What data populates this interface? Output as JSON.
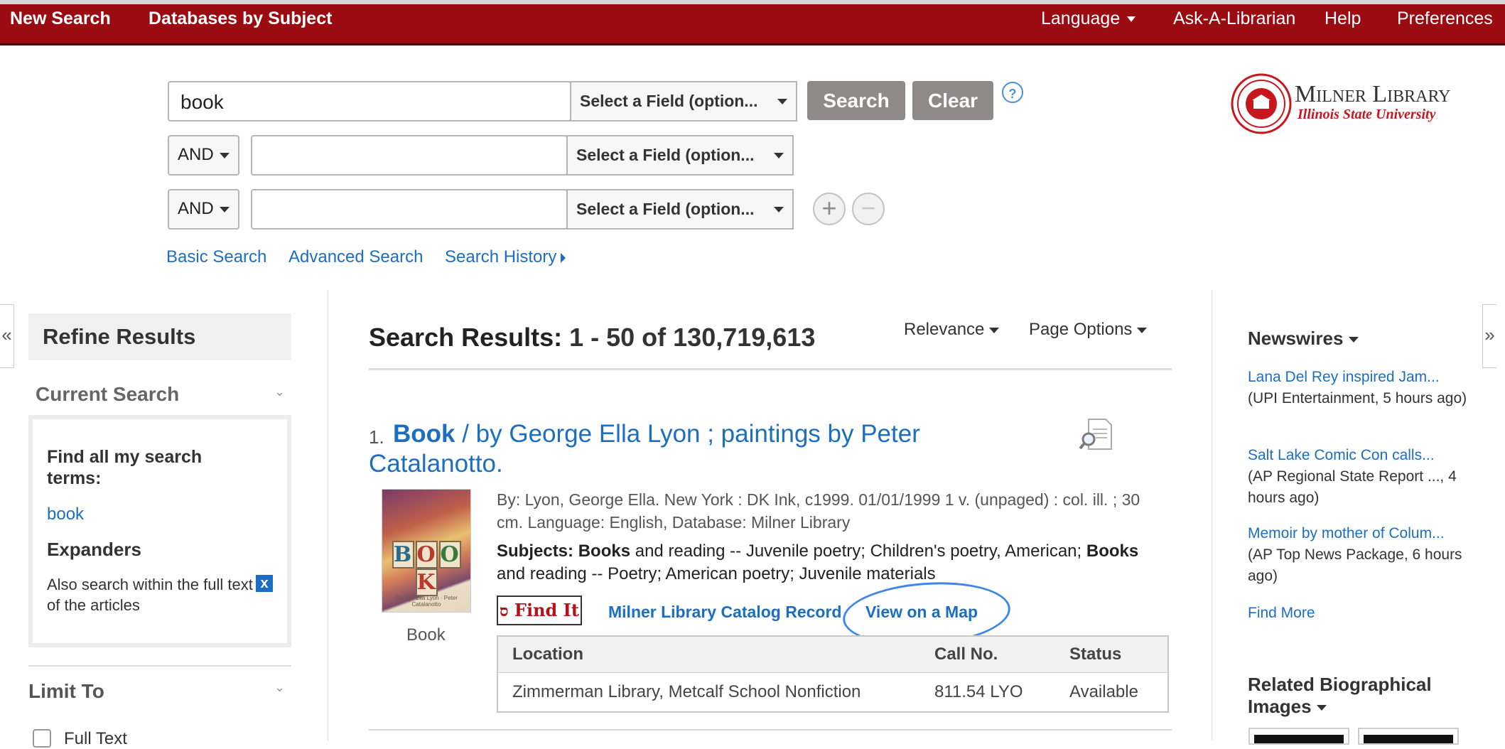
{
  "topbar": {
    "new_search": "New Search",
    "databases": "Databases by Subject",
    "language": "Language",
    "ask": "Ask-A-Librarian",
    "help": "Help",
    "preferences": "Preferences"
  },
  "search": {
    "query": "book",
    "field_placeholder": "Select a Field (option...",
    "row2_value": "",
    "row3_value": "",
    "bool1": "AND",
    "bool2": "AND",
    "search_btn": "Search",
    "clear_btn": "Clear",
    "help_icon": "?",
    "add_row_icon": "+",
    "remove_row_icon": "−",
    "links": {
      "basic": "Basic Search",
      "advanced": "Advanced Search",
      "history": "Search History"
    }
  },
  "logo": {
    "title": "Milner Library",
    "subtitle": "Illinois State University"
  },
  "colors": {
    "brand_red": "#9b0b12",
    "link_blue": "#1b6ec2",
    "button_gray": "#8f8a8a"
  },
  "left": {
    "collapse_icon": "«",
    "refine": "Refine Results",
    "current_search": "Current Search",
    "find_all": "Find all my search terms:",
    "term": "book",
    "expanders": "Expanders",
    "expander_text": "Also search within the full text of the articles",
    "remove_icon": "x",
    "limit_to": "Limit To",
    "full_text": "Full Text"
  },
  "results": {
    "label": "Search Results:",
    "range": "1 - 50 of 130,719,613",
    "sort": "Relevance",
    "page_options": "Page Options",
    "item": {
      "num": "1.",
      "title_bold": "Book",
      "title_rest": " / by George Ella Lyon ; paintings by Peter Catalanotto.",
      "meta": "By: Lyon, George Ella. New York : DK Ink, c1999. 01/01/1999 1 v. (unpaged) : col. ill. ; 30 cm. Language: English, Database: Milner Library",
      "subjects_label": "Subjects:",
      "subjects_b1": "Books",
      "subjects_t1": " and reading -- Juvenile poetry; Children's poetry, American; ",
      "subjects_b2": "Books",
      "subjects_t2": " and reading -- Poetry; American poetry; Juvenile materials",
      "cover_letters": [
        "B",
        "O",
        "O",
        "K"
      ],
      "cover_caption": "George Ella Lyon · Peter Catalanotto",
      "type": "Book",
      "find_it": "Find It",
      "catalog_link": "Milner Library Catalog Record",
      "map_link": "View on a Map",
      "holdings": {
        "headers": [
          "Location",
          "Call No.",
          "Status"
        ],
        "rows": [
          [
            "Zimmerman Library, Metcalf School Nonfiction",
            "811.54 LYO",
            "Available"
          ]
        ]
      }
    }
  },
  "right": {
    "expand_icon": "»",
    "newswires": "Newswires",
    "news": [
      {
        "title": "Lana Del Rey inspired Jam...",
        "source": "(UPI Entertainment, 5 hours ago)"
      },
      {
        "title": "Salt Lake Comic Con calls...",
        "source": "(AP Regional State Report ..., 4 hours ago)"
      },
      {
        "title": "Memoir by mother of Colum...",
        "source": "(AP Top News Package, 6 hours ago)"
      }
    ],
    "find_more": "Find More",
    "related": "Related Biographical Images"
  }
}
